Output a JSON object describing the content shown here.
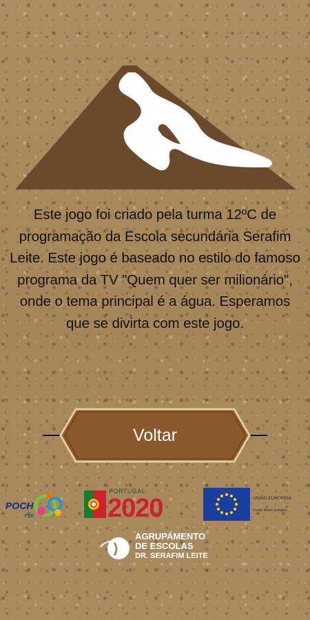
{
  "about": {
    "text": "Este jogo foi criado pela turma 12ºC de programação da Escola secundária Serafim Leite. Este jogo é baseado no estilo do famoso programa da TV \"Quem quer ser milionário\", onde o tema principal é a água. Esperamos que se divirta com este jogo."
  },
  "actions": {
    "back_label": "Voltar"
  },
  "footer": {
    "poch": {
      "name": "POCH",
      "sub": "FSE"
    },
    "portugal2020": {
      "small": "PORTUGAL",
      "big": "2020"
    },
    "eu": {
      "title": "UNIÃO EUROPEIA",
      "sub": "Fundo Social Europeu"
    },
    "school": {
      "line1": "AGRUPAMENTO",
      "line2": "DE ESCOLAS",
      "line3": "DR. SERAFIM LEITE"
    }
  },
  "colors": {
    "mountain": "#6b4a2c",
    "snow": "#ffffff",
    "button": "#8a5a2e",
    "button_border": "#e8c9a0",
    "background": "#a88a5f"
  }
}
